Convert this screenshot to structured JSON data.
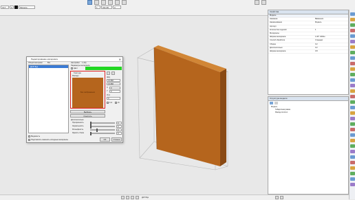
{
  "toolbar": {
    "field_left": "XLT",
    "field_value": "0",
    "material_field": "Модель",
    "coord_a": "1",
    "coord_b": "311.95",
    "coord_c": "0",
    "top_icons": [
      "select-icon",
      "rotate-icon",
      "zoom-icon",
      "pan-icon",
      "view-icon",
      "measure-icon",
      "layers-icon",
      "snap-icon"
    ]
  },
  "properties_panel": {
    "title": "Свойства",
    "subtitle": "Модель",
    "rows": [
      {
        "k": "Название",
        "v": "Ввёжения"
      },
      {
        "k": "Наименование",
        "v": "Модель"
      },
      {
        "k": "Артикул",
        "v": ""
      },
      {
        "k": "Количество изделий",
        "v": "1"
      },
      {
        "k": "Материалы",
        "v": ""
      },
      {
        "k": "Ширина материала",
        "v": "1.00* 1300ш"
      },
      {
        "k": "Способ обработки",
        "v": "Стандарт"
      },
      {
        "k": "Сборка",
        "v": "0.2"
      },
      {
        "k": "Дополнительно",
        "v": "0.2"
      },
      {
        "k": "Ширина материала",
        "v": "0.8"
      }
    ]
  },
  "structure_panel": {
    "title": "Структура модели",
    "items": [
      "Модель",
      "Габаритная рамка",
      "Фасад-полотно"
    ]
  },
  "dialog": {
    "title": "Редактирование материала",
    "tab_general": "Общий материал",
    "tab_all": "Все",
    "list_item": "ДСП Бук",
    "settings_label": "Настройки",
    "settings_value": "1 обр",
    "param_label": "Параметры материала",
    "color_label": "Цвет",
    "texture_label": "Текстура",
    "texture_sub": "Фасады",
    "preview_text": "Без изображения",
    "field_w_label": "Шир",
    "field_w": "0.1360",
    "field_h": "0.1360",
    "field_x_label": "X",
    "field_x": "0",
    "field_y_label": "Y",
    "field_y": "0",
    "angle_label": "Угол",
    "angle": "0",
    "checkbox_a": "1x1",
    "checkbox_b": "2x",
    "button_choose": "Выбрать",
    "button_clear": "Очистить",
    "extra_label": "Дополнительно",
    "sliders": [
      {
        "label": "Прозрачность",
        "value": "0",
        "level": 0.0
      },
      {
        "label": "Зеркальность",
        "value": "0",
        "level": 0.0
      },
      {
        "label": "Рельефность",
        "value": "0",
        "level": 0.25
      },
      {
        "label": "Яркость блика",
        "value": "0",
        "level": 0.0
      }
    ],
    "footer_chk1": "Видимость",
    "footer_chk2": "Подставлять заменять исходные материалы",
    "btn_ok": "OK",
    "btn_cancel": "Отмена",
    "accent_green": "#22d622",
    "accent_red": "#e02020"
  },
  "statusbar": {
    "text": "ДСП Бук",
    "icons": [
      "grid-icon",
      "snap-icon",
      "ortho-icon",
      "layers-icon",
      "lock-icon",
      "view-icon"
    ]
  },
  "colors": {
    "wood": "#b5651d",
    "wood_dark": "#8a4a14"
  }
}
